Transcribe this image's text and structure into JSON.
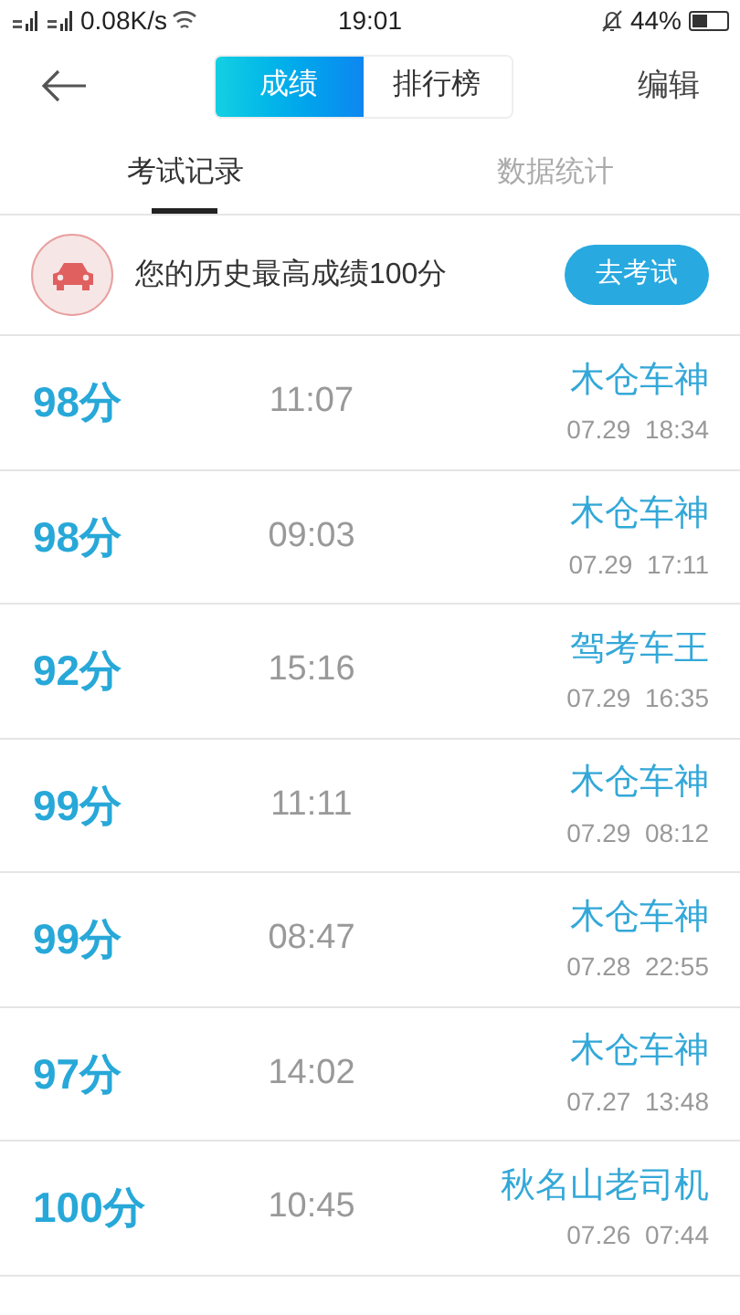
{
  "status_bar": {
    "speed": "0.08K/s",
    "time": "19:01",
    "battery": "44%"
  },
  "header": {
    "segments": [
      {
        "label": "成绩",
        "selected": true
      },
      {
        "label": "排行榜",
        "selected": false
      }
    ],
    "action": "编辑"
  },
  "tabs": [
    {
      "label": "考试记录",
      "selected": true
    },
    {
      "label": "数据统计",
      "selected": false
    }
  ],
  "banner": {
    "text": "您的历史最高成绩100分",
    "button": "去考试"
  },
  "records": [
    {
      "score": "98分",
      "duration": "11:07",
      "title": "木仓车神",
      "date": "07.29  18:34"
    },
    {
      "score": "98分",
      "duration": "09:03",
      "title": "木仓车神",
      "date": "07.29  17:11"
    },
    {
      "score": "92分",
      "duration": "15:16",
      "title": "驾考车王",
      "date": "07.29  16:35"
    },
    {
      "score": "99分",
      "duration": "11:11",
      "title": "木仓车神",
      "date": "07.29  08:12"
    },
    {
      "score": "99分",
      "duration": "08:47",
      "title": "木仓车神",
      "date": "07.28  22:55"
    },
    {
      "score": "97分",
      "duration": "14:02",
      "title": "木仓车神",
      "date": "07.27  13:48"
    },
    {
      "score": "100分",
      "duration": "10:45",
      "title": "秋名山老司机",
      "date": "07.26  07:44"
    }
  ]
}
